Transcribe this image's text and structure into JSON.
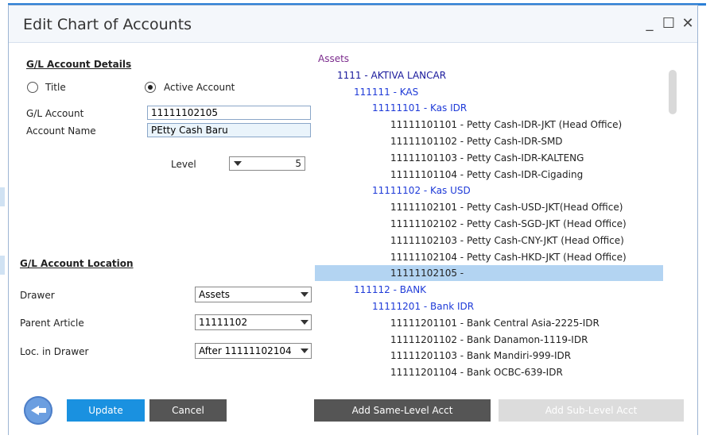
{
  "window": {
    "title": "Edit Chart of Accounts",
    "controls": {
      "minimize": "_",
      "maximize": "☐",
      "close": "✕"
    }
  },
  "details": {
    "section_title": "G/L Account Details",
    "radio_title": {
      "label": "Title",
      "checked": false
    },
    "radio_active": {
      "label": "Active Account",
      "checked": true
    },
    "gl_account_label": "G/L Account",
    "gl_account_value": "11111102105",
    "account_name_label": "Account Name",
    "account_name_value": "PEtty Cash Baru",
    "level_label": "Level",
    "level_value": "5"
  },
  "location": {
    "section_title": "G/L Account Location",
    "drawer_label": "Drawer",
    "drawer_value": "Assets",
    "parent_article_label": "Parent Article",
    "parent_article_value": "11111102",
    "loc_in_drawer_label": "Loc. in Drawer",
    "loc_in_drawer_value": "After 11111102104"
  },
  "tree": {
    "rows": [
      {
        "text": "Assets",
        "indent": 0,
        "color": "#7a2a8c",
        "selected": false
      },
      {
        "text": "1111 - AKTIVA LANCAR",
        "indent": 1,
        "color": "#1a1a9c",
        "selected": false
      },
      {
        "text": "111111 - KAS",
        "indent": 2,
        "color": "#1f3bd8",
        "selected": false
      },
      {
        "text": "11111101 - Kas IDR",
        "indent": 3,
        "color": "#1f3bd8",
        "selected": false
      },
      {
        "text": "11111101101 - Petty Cash-IDR-JKT (Head Office)",
        "indent": 4,
        "color": "#222222",
        "selected": false
      },
      {
        "text": "11111101102 - Petty Cash-IDR-SMD",
        "indent": 4,
        "color": "#222222",
        "selected": false
      },
      {
        "text": "11111101103 - Petty Cash-IDR-KALTENG",
        "indent": 4,
        "color": "#222222",
        "selected": false
      },
      {
        "text": "11111101104 - Petty Cash-IDR-Cigading",
        "indent": 4,
        "color": "#222222",
        "selected": false
      },
      {
        "text": "11111102 - Kas USD",
        "indent": 3,
        "color": "#1f3bd8",
        "selected": false
      },
      {
        "text": "11111102101 - Petty Cash-USD-JKT(Head Office)",
        "indent": 4,
        "color": "#222222",
        "selected": false
      },
      {
        "text": "11111102102 - Petty Cash-SGD-JKT (Head Office)",
        "indent": 4,
        "color": "#222222",
        "selected": false
      },
      {
        "text": "11111102103 - Petty Cash-CNY-JKT (Head Office)",
        "indent": 4,
        "color": "#222222",
        "selected": false
      },
      {
        "text": "11111102104 - Petty Cash-HKD-JKT (Head Office)",
        "indent": 4,
        "color": "#222222",
        "selected": false
      },
      {
        "text": "11111102105 -",
        "indent": 4,
        "color": "#222222",
        "selected": true
      },
      {
        "text": "111112 - BANK",
        "indent": 2,
        "color": "#1f3bd8",
        "selected": false
      },
      {
        "text": "11111201 - Bank IDR",
        "indent": 3,
        "color": "#1f3bd8",
        "selected": false
      },
      {
        "text": "11111201101 - Bank Central Asia-2225-IDR",
        "indent": 4,
        "color": "#222222",
        "selected": false
      },
      {
        "text": "11111201102 - Bank Danamon-1119-IDR",
        "indent": 4,
        "color": "#222222",
        "selected": false
      },
      {
        "text": "11111201103 - Bank Mandiri-999-IDR",
        "indent": 4,
        "color": "#222222",
        "selected": false
      },
      {
        "text": "11111201104 - Bank OCBC-639-IDR",
        "indent": 4,
        "color": "#222222",
        "selected": false
      }
    ]
  },
  "buttons": {
    "update": "Update",
    "cancel": "Cancel",
    "add_same_level": "Add Same-Level Acct",
    "add_sub_level": "Add Sub-Level Acct"
  },
  "colors": {
    "primary_button": "#1a91e0",
    "dark_button": "#555555",
    "disabled_button": "#dcdcdc",
    "selection": "#b3d4f2",
    "title_bar_accent": "#2b7fd6"
  }
}
